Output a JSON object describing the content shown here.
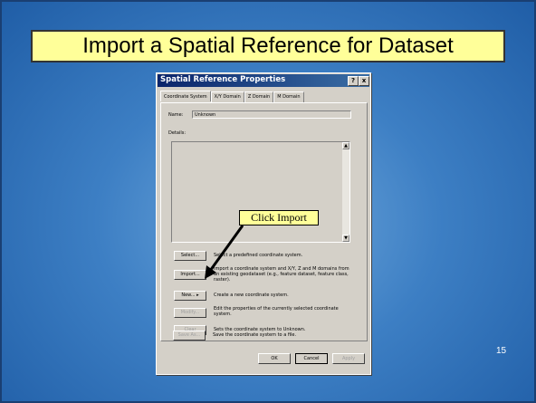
{
  "slide": {
    "title": "Import a Spatial Reference for Dataset",
    "page_number": "15"
  },
  "dialog": {
    "title": "Spatial Reference Properties",
    "help_button": "?",
    "close_button": "x",
    "tabs": [
      "Coordinate System",
      "X/Y Domain",
      "Z Domain",
      "M Domain"
    ],
    "name_label": "Name:",
    "name_value": "Unknown",
    "details_label": "Details:",
    "actions": [
      {
        "label": "Select...",
        "description": "Select a predefined coordinate system.",
        "enabled": true
      },
      {
        "label": "Import...",
        "description": "Import a coordinate system and X/Y, Z and M domains from an existing geodataset (e.g., feature dataset, feature class, raster).",
        "enabled": true
      },
      {
        "label": "New...  ▸",
        "description": "Create a new coordinate system.",
        "enabled": true
      },
      {
        "label": "Modify...",
        "description": "Edit the properties of the currently selected coordinate system.",
        "enabled": false
      },
      {
        "label": "Clear",
        "description": "Sets the coordinate system to Unknown.",
        "enabled": false
      },
      {
        "label": "Save As...",
        "description": "Save the coordinate system to a file.",
        "enabled": false
      }
    ],
    "footer": {
      "ok": "OK",
      "cancel": "Cancel",
      "apply": "Apply"
    }
  },
  "callout": {
    "text": "Click Import"
  },
  "colors": {
    "callout_bg": "#ffff99",
    "title_bar": "#0a246a"
  }
}
